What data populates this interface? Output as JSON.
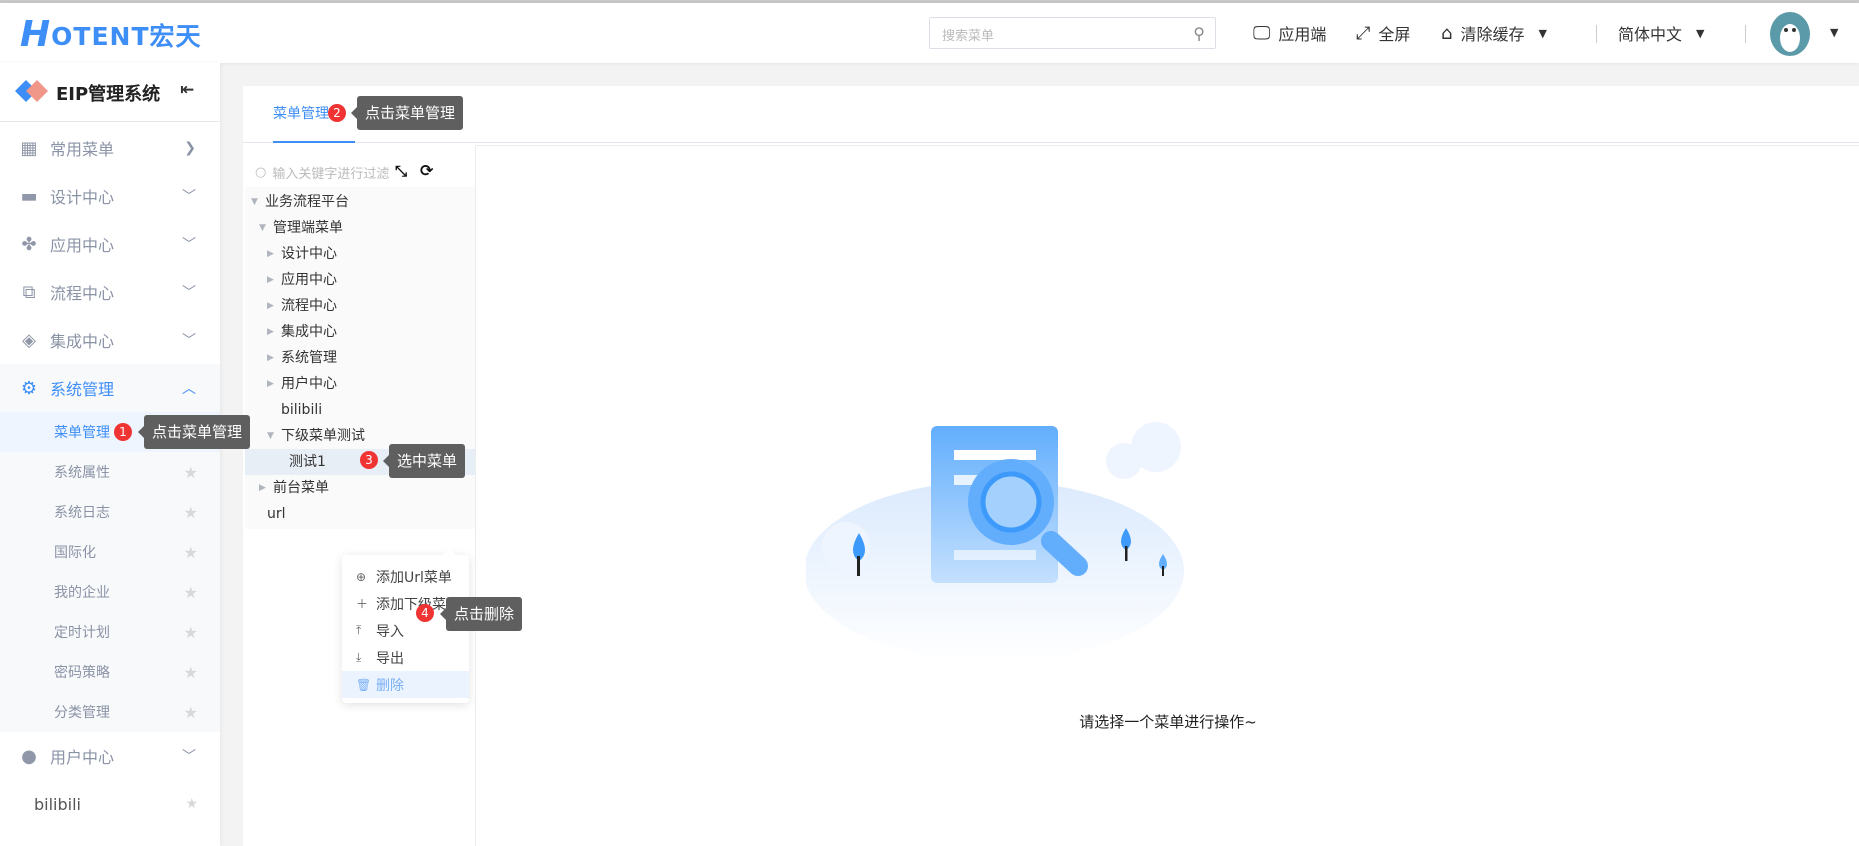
{
  "header": {
    "logo_text": "OTENT宏天",
    "logo_letter": "H",
    "search_placeholder": "搜索菜单",
    "app_label": "应用端",
    "fullscreen_label": "全屏",
    "clear_cache_label": "清除缓存",
    "language_label": "简体中文"
  },
  "sidebar": {
    "title": "EIP管理系统",
    "menus": [
      {
        "label": "常用菜单",
        "icon": "grid-icon"
      },
      {
        "label": "设计中心",
        "icon": "card-icon"
      },
      {
        "label": "应用中心",
        "icon": "apps-icon"
      },
      {
        "label": "流程中心",
        "icon": "flow-icon"
      },
      {
        "label": "集成中心",
        "icon": "layers-icon"
      },
      {
        "label": "系统管理",
        "icon": "gear-icon"
      }
    ],
    "submenus": [
      "菜单管理",
      "系统属性",
      "系统日志",
      "国际化",
      "我的企业",
      "定时计划",
      "密码策略",
      "分类管理"
    ],
    "user_center": "用户中心",
    "bilibili": "bilibili"
  },
  "tabs": [
    {
      "label": "菜单管理"
    }
  ],
  "tree": {
    "filter_placeholder": "输入关键字进行过滤",
    "nodes": [
      "业务流程平台",
      "管理端菜单",
      "设计中心",
      "应用中心",
      "流程中心",
      "集成中心",
      "系统管理",
      "用户中心",
      "bilibili",
      "下级菜单测试",
      "测试1",
      "前台菜单",
      "url"
    ]
  },
  "context_menu": [
    "添加Url菜单",
    "添加下级菜单",
    "导入",
    "导出",
    "删除"
  ],
  "steps": [
    {
      "n": "1",
      "text": "点击菜单管理"
    },
    {
      "n": "2",
      "text": "点击菜单管理"
    },
    {
      "n": "3",
      "text": "选中菜单"
    },
    {
      "n": "4",
      "text": "点击删除"
    }
  ],
  "empty_text": "请选择一个菜单进行操作~",
  "colors": {
    "accent": "#3d8ef7",
    "badge": "#f03333",
    "tooltip": "#5f5f5f"
  }
}
